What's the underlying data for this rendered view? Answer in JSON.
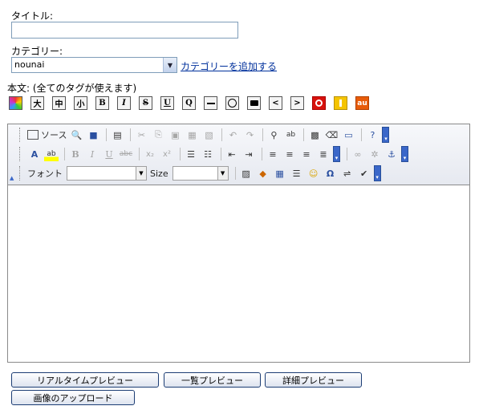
{
  "form": {
    "title_label": "タイトル:",
    "title_value": "",
    "category_label": "カテゴリー:",
    "category_selected": "nounai",
    "add_category_link": "カテゴリーを追加する",
    "body_label": "本文: (全てのタグが使えます)"
  },
  "tag_buttons": {
    "large": "大",
    "medium": "中",
    "small": "小",
    "bold": "B",
    "italic": "I",
    "strike": "S",
    "underline": "U",
    "quote": "Q",
    "au": "au"
  },
  "editor_toolbar": {
    "source_label": "ソース",
    "font_label": "フォント",
    "font_value": "",
    "size_label": "Size",
    "size_value": "",
    "bold": "B",
    "italic": "I",
    "underline": "U",
    "strike": "abc",
    "subscript": "x₂",
    "superscript": "x²",
    "omega": "Ω"
  },
  "editor_content": "",
  "buttons": {
    "realtime_preview": "リアルタイムプレビュー",
    "list_preview": "一覧プレビュー",
    "detail_preview": "詳細プレビュー",
    "upload_image": "画像のアップロード"
  },
  "colors": {
    "link": "#00309c",
    "toolbar_more": "#3a67c9",
    "docomo_red": "#d8120d",
    "softbank_yellow": "#f5c400",
    "au_orange": "#e85c0a"
  }
}
